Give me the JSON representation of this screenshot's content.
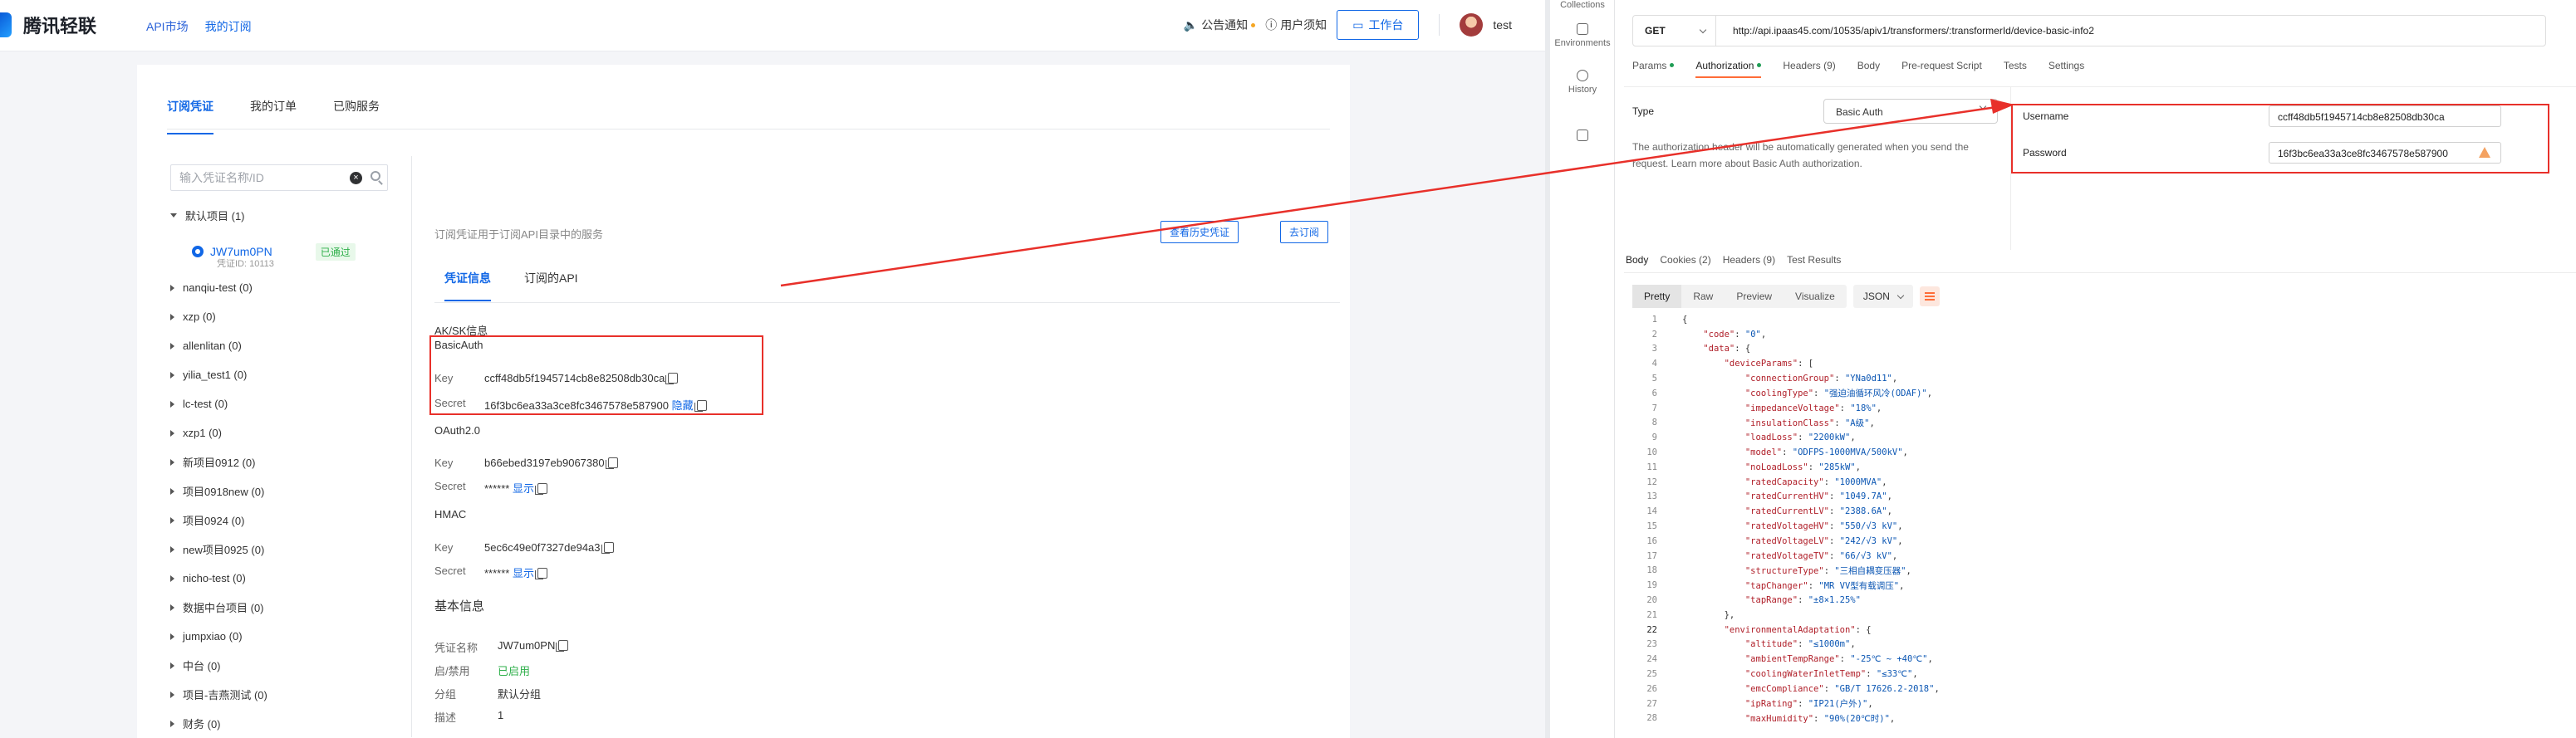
{
  "left": {
    "brand": "腾讯轻联",
    "nav": [
      "API市场",
      "我的订阅"
    ],
    "header": {
      "notice": "公告通知",
      "help": "用户须知",
      "workbench": "工作台",
      "username": "test"
    },
    "tabs": [
      "订阅凭证",
      "我的订单",
      "已购服务"
    ],
    "search": {
      "placeholder": "输入凭证名称/ID",
      "clear": "×"
    },
    "tree": {
      "root": "默认项目 (1)",
      "child": {
        "name": "JW7um0PN",
        "sub": "凭证ID: 10113",
        "badge": "已通过"
      },
      "items": [
        "nanqiu-test (0)",
        "xzp (0)",
        "allenlitan (0)",
        "yilia_test1 (0)",
        "lc-test (0)",
        "xzp1 (0)",
        "新项目0912 (0)",
        "项目0918new (0)",
        "项目0924 (0)",
        "new项目0925 (0)",
        "nicho-test (0)",
        "数据中台项目 (0)",
        "jumpxiao (0)",
        "中台 (0)",
        "项目-吉燕测试 (0)",
        "财务 (0)"
      ]
    },
    "detail": {
      "hint": "订阅凭证用于订阅API目录中的服务",
      "history_btn": "查看历史凭证",
      "subscribe_btn": "去订阅",
      "tabs": [
        "凭证信息",
        "订阅的API"
      ],
      "aksk_title": "AK/SK信息",
      "basic": {
        "title": "BasicAuth",
        "key_label": "Key",
        "key": "ccff48db5f1945714cb8e82508db30ca",
        "secret_label": "Secret",
        "secret": "16f3bc6ea33a3ce8fc3467578e587900",
        "hide": "隐藏"
      },
      "oauth": {
        "title": "OAuth2.0",
        "key_label": "Key",
        "key": "b66ebed3197eb9067380",
        "secret_label": "Secret",
        "secret": "******",
        "show": "显示"
      },
      "hmac": {
        "title": "HMAC",
        "key_label": "Key",
        "key": "5ec6c49e0f7327de94a3",
        "secret_label": "Secret",
        "secret": "******",
        "show": "显示"
      },
      "basic_info": {
        "title": "基本信息",
        "name_label": "凭证名称",
        "name": "JW7um0PN",
        "status_label": "启/禁用",
        "status": "已启用",
        "group_label": "分组",
        "group": "默认分组",
        "desc_label": "描述",
        "desc": "1"
      }
    }
  },
  "postman": {
    "rail": [
      "Collections",
      "Environments",
      "History"
    ],
    "method": "GET",
    "url": "http://api.ipaas45.com/10535/apiv1/transformers/:transformerId/device-basic-info2",
    "req_tabs": [
      "Params",
      "Authorization",
      "Headers (9)",
      "Body",
      "Pre-request Script",
      "Tests",
      "Settings"
    ],
    "auth": {
      "type_label": "Type",
      "type_value": "Basic Auth",
      "desc": "The authorization header will be automatically generated when you send the request. Learn more about Basic Auth authorization.",
      "username_label": "Username",
      "username": "ccff48db5f1945714cb8e82508db30ca",
      "password_label": "Password",
      "password": "16f3bc6ea33a3ce8fc3467578e587900"
    },
    "resp_tabs": [
      "Body",
      "Cookies (2)",
      "Headers (9)",
      "Test Results"
    ],
    "view_modes": [
      "Pretty",
      "Raw",
      "Preview",
      "Visualize"
    ],
    "format": "JSON",
    "code_lines": [
      {
        "n": "1",
        "t": "{"
      },
      {
        "n": "2",
        "t": "    \"code\": \"0\","
      },
      {
        "n": "3",
        "t": "    \"data\": {"
      },
      {
        "n": "4",
        "t": "        \"deviceParams\": ["
      },
      {
        "n": "5",
        "t": "            \"connectionGroup\": \"YNa0d11\","
      },
      {
        "n": "6",
        "t": "            \"coolingType\": \"强迫油循环风冷(ODAF)\","
      },
      {
        "n": "7",
        "t": "            \"impedanceVoltage\": \"18%\","
      },
      {
        "n": "8",
        "t": "            \"insulationClass\": \"A级\","
      },
      {
        "n": "9",
        "t": "            \"loadLoss\": \"2200kW\","
      },
      {
        "n": "10",
        "t": "            \"model\": \"ODFPS-1000MVA/500kV\","
      },
      {
        "n": "11",
        "t": "            \"noLoadLoss\": \"285kW\","
      },
      {
        "n": "12",
        "t": "            \"ratedCapacity\": \"1000MVA\","
      },
      {
        "n": "13",
        "t": "            \"ratedCurrentHV\": \"1049.7A\","
      },
      {
        "n": "14",
        "t": "            \"ratedCurrentLV\": \"2388.6A\","
      },
      {
        "n": "15",
        "t": "            \"ratedVoltageHV\": \"550/√3 kV\","
      },
      {
        "n": "16",
        "t": "            \"ratedVoltageLV\": \"242/√3 kV\","
      },
      {
        "n": "17",
        "t": "            \"ratedVoltageTV\": \"66/√3 kV\","
      },
      {
        "n": "18",
        "t": "            \"structureType\": \"三相自耦变压器\","
      },
      {
        "n": "19",
        "t": "            \"tapChanger\": \"MR VV型有载调压\","
      },
      {
        "n": "20",
        "t": "            \"tapRange\": \"±8×1.25%\""
      },
      {
        "n": "21",
        "t": "        },"
      },
      {
        "n": "22",
        "t": "        \"environmentalAdaptation\": {"
      },
      {
        "n": "23",
        "t": "            \"altitude\": \"≤1000m\","
      },
      {
        "n": "24",
        "t": "            \"ambientTempRange\": \"-25℃ ~ +40℃\","
      },
      {
        "n": "25",
        "t": "            \"coolingWaterInletTemp\": \"≤33℃\","
      },
      {
        "n": "26",
        "t": "            \"emcCompliance\": \"GB/T 17626.2-2018\","
      },
      {
        "n": "27",
        "t": "            \"ipRating\": \"IP21(户外)\","
      },
      {
        "n": "28",
        "t": "            \"maxHumidity\": \"90%(20℃时)\","
      }
    ]
  },
  "colors": {
    "accent": "#1167e6",
    "highlight_box": "#e8302a",
    "postman_orange": "#ff6c37"
  }
}
